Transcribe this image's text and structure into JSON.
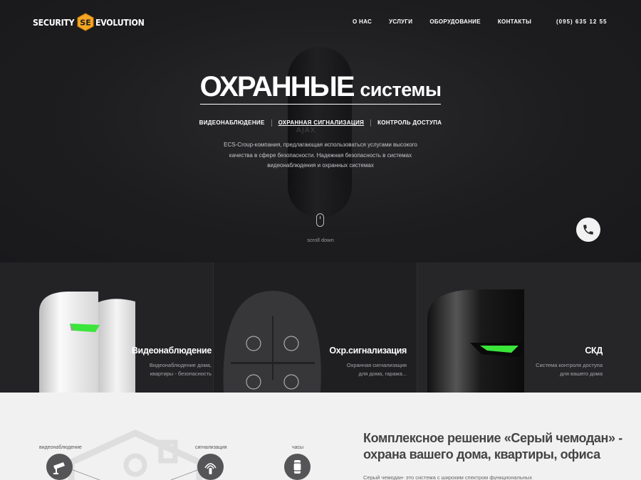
{
  "brand": {
    "left": "SECURITY",
    "right": "EVOLUTION",
    "badge_letters": "SE",
    "accent": "#f5a623"
  },
  "nav": [
    "О НАС",
    "УСЛУГИ",
    "ОБОРУДОВАНИЕ",
    "КОНТАКТЫ"
  ],
  "phone": "(095) 635 12 55",
  "hero": {
    "title_bold": "ОХРАННЫЕ",
    "title_light": "системы",
    "tabs": [
      {
        "label": "ВИДЕОНАБЛЮДЕНИЕ",
        "active": false
      },
      {
        "label": "ОХРАННАЯ СИГНАЛИЗАЦИЯ",
        "active": true
      },
      {
        "label": "КОНТРОЛЬ ДОСТУПА",
        "active": false
      }
    ],
    "description": [
      "ECS-Croup-компания, предлагающая использоваться услугами высокого",
      "качества в сфере безопасности. Надежная безопасность в системах",
      "видеонаблюдения и охранных системах"
    ],
    "device_mark": "AJAX",
    "scroll_label": "scroll down"
  },
  "cards": [
    {
      "title": "Видеонаблюдение",
      "desc": [
        "Видеонаблюдение дома,",
        "квартиры - безопасность"
      ]
    },
    {
      "title": "Охр.сигнализация",
      "desc": [
        "Охранная сигнализация",
        "для дома, гаража..."
      ]
    },
    {
      "title": "СКД",
      "desc": [
        "Система контроля доступа",
        "для вашего дома"
      ]
    }
  ],
  "features": [
    "видеонаблюдение",
    "сигнализация",
    "часы"
  ],
  "lower": {
    "title_lines": [
      "Комплексное решение «Серый чемодан» -",
      "охрана вашего дома, квартиры, офиса"
    ],
    "text": "Серый чемодан- это система с широким спектром функциональных"
  },
  "colors": {
    "accent_green": "#39e639",
    "hero_bg": "#1d1d1f",
    "lower_bg": "#f1f1f1"
  }
}
